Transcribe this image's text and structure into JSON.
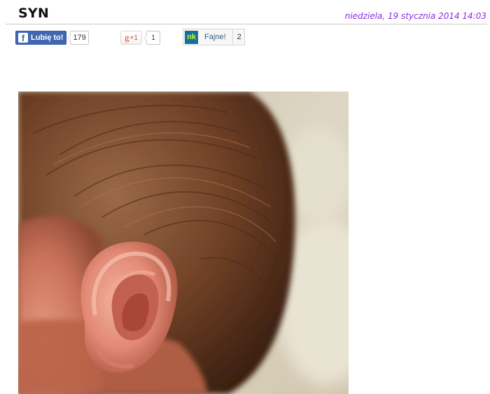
{
  "post": {
    "title": "SYN",
    "date": "niedziela, 19 stycznia 2014 14:03"
  },
  "social": {
    "facebook": {
      "label": "Lubię to!",
      "logo": "f",
      "count": "179"
    },
    "gplus": {
      "label": "+1",
      "logo": "g",
      "count": "1"
    },
    "nk": {
      "logo": "nk",
      "label": "Fajne!",
      "count": "2"
    }
  },
  "colors": {
    "date": "#8a2be2",
    "facebook": "#4267b2",
    "gplus": "#dd4b39",
    "nk": "#1b6d9a"
  },
  "image": {
    "subject": "baby-ear-photo"
  }
}
